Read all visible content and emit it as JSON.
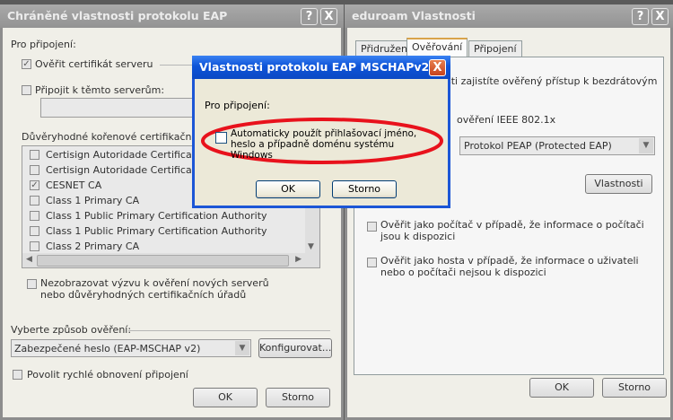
{
  "left_dialog": {
    "title": "Chráněné vlastnosti protokolu EAP",
    "help_label": "?",
    "close_label": "X",
    "connect_section_label": "Pro připojení:",
    "verify_cert_label": "Ověřit certifikát serveru",
    "verify_cert_checked_mark": "✓",
    "connect_servers_label": "Připojit k těmto serverům:",
    "trusted_ca_label": "Důvěryhodné kořenové certifikační úřad",
    "ca_items": [
      {
        "label": "Certisign Autoridade Certificadora",
        "mark": ""
      },
      {
        "label": "Certisign Autoridade Certificadora",
        "mark": ""
      },
      {
        "label": "CESNET CA",
        "mark": "✓"
      },
      {
        "label": "Class 1 Primary CA",
        "mark": ""
      },
      {
        "label": "Class 1 Public Primary Certification Authority",
        "mark": ""
      },
      {
        "label": "Class 1 Public Primary Certification Authority",
        "mark": ""
      },
      {
        "label": "Class 2 Primary CA",
        "mark": ""
      }
    ],
    "no_prompt_label": "Nezobrazovat výzvu k ověření nových serverů nebo důvěryhodných certifikačních úřadů",
    "auth_method_label": "Vyberte způsob ověření:",
    "auth_method_value": "Zabezpečené heslo (EAP-MSCHAP v2)",
    "configure_label": "Konfigurovat...",
    "fast_reconnect_label": "Povolit rychlé obnovení připojení",
    "ok_label": "OK",
    "cancel_label": "Storno"
  },
  "right_dialog": {
    "title": "eduroam Vlastnosti",
    "help_label": "?",
    "close_label": "X",
    "tabs": [
      "Přidružení",
      "Ověřování",
      "Připojení"
    ],
    "intro_text_partial": "sti zajistíte ověřený přístup k bezdrátovým",
    "ieee_text_partial": "ověření IEEE 802.1x",
    "eap_type_value": "Protokol PEAP (Protected EAP)",
    "properties_label": "Vlastnosti",
    "auth_as_computer_label": "Ověřit jako počítač v případě, že informace o počítači jsou k dispozici",
    "auth_as_guest_label": "Ověřit jako hosta v případě, že informace o uživateli nebo o počítači nejsou k dispozici",
    "ok_label": "OK",
    "cancel_label": "Storno"
  },
  "mschap_dialog": {
    "title": "Vlastnosti protokolu EAP MSCHAPv2",
    "close_label": "X",
    "section_label": "Pro připojení:",
    "auto_logon_label": "Automaticky použít přihlašovací jméno, heslo a případně doménu systému Windows",
    "ok_label": "OK",
    "cancel_label": "Storno"
  },
  "colors": {
    "highlight_ellipse": "#e8121c",
    "xp_title_blue": "#0e54d8",
    "xp_close_red": "#c6421d"
  }
}
